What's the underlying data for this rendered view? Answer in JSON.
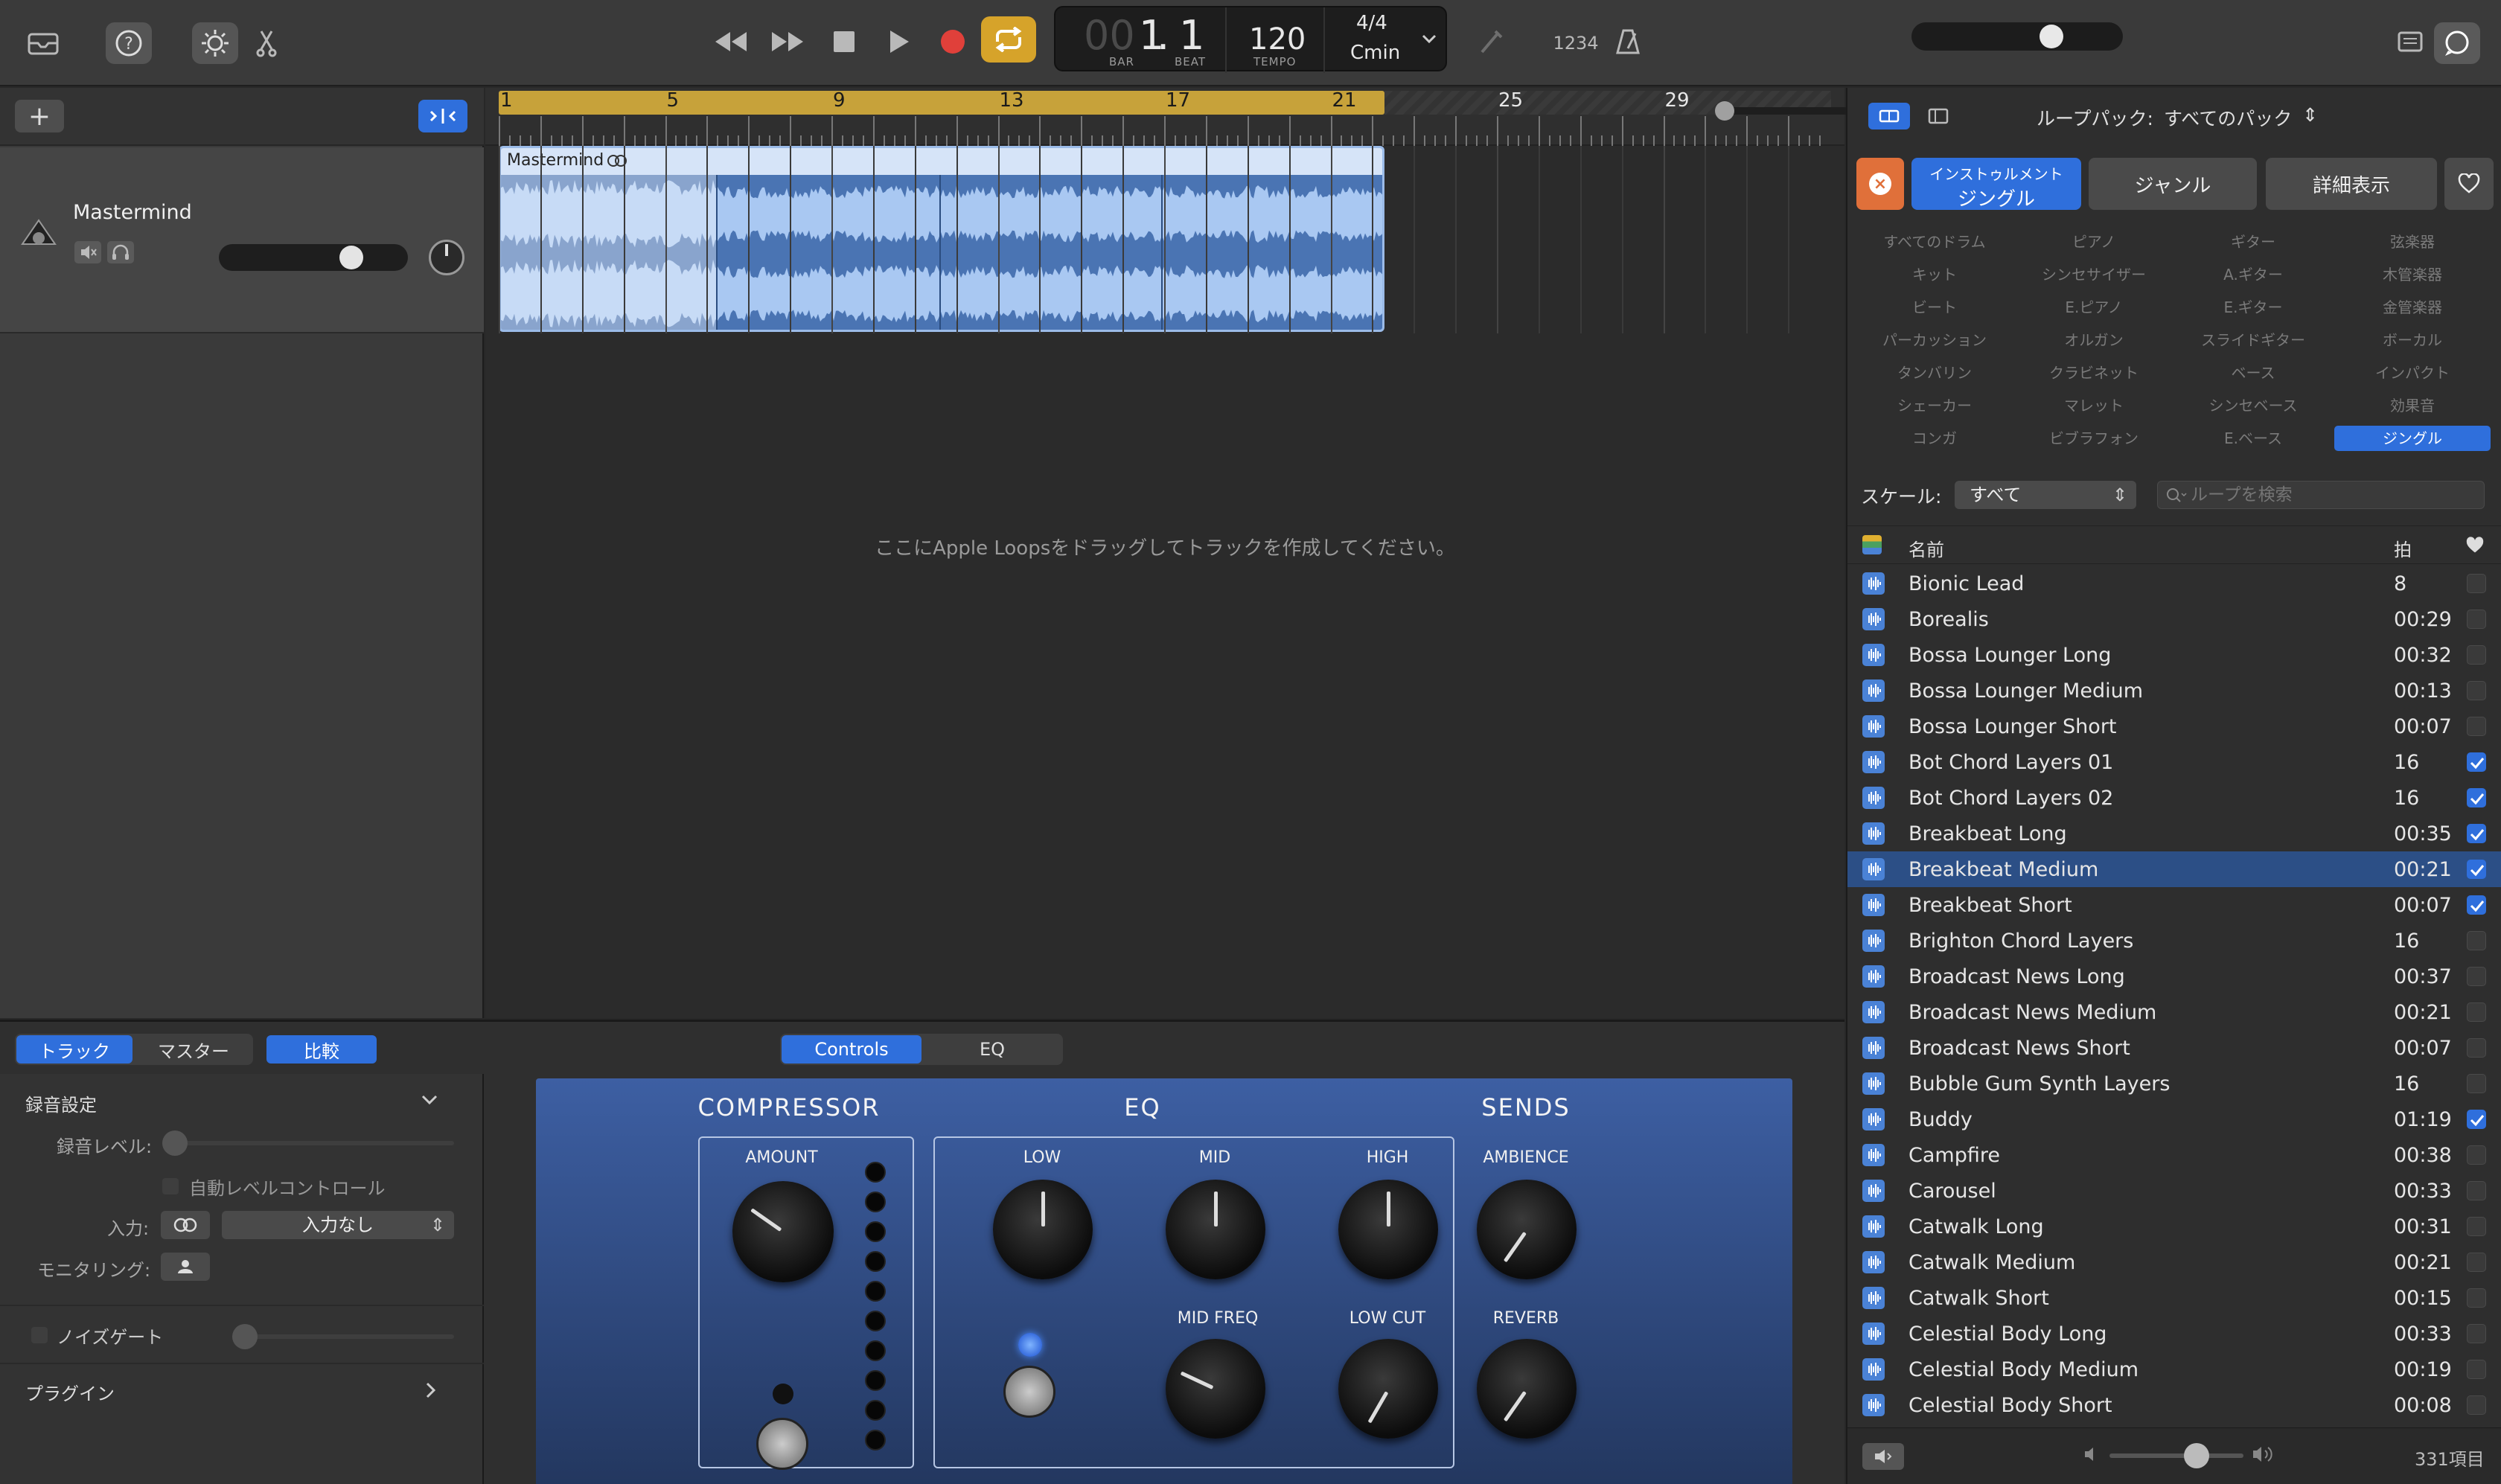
{
  "toolbar": {
    "lcd": {
      "bar_prefix": "00",
      "bar": "1",
      "beat": "1",
      "bar_label": "BAR",
      "beat_label": "BEAT",
      "tempo": "120",
      "tempo_label": "TEMPO",
      "signature": "4/4",
      "key": "Cmin"
    },
    "count_in": "1234",
    "accent_color": "#d6a32a"
  },
  "tracks": {
    "add_label": "+",
    "items": [
      {
        "name": "Mastermind"
      }
    ]
  },
  "arrangement": {
    "ruler_marks": [
      "1",
      "5",
      "9",
      "13",
      "17",
      "21",
      "25",
      "29"
    ],
    "region_name": "Mastermind",
    "empty_hint": "ここにApple Loopsをドラッグしてトラックを作成してください。"
  },
  "browser": {
    "loop_pack_label": "ループパック:",
    "loop_pack_value": "すべてのパック",
    "filter_tag_line1": "インストゥルメント",
    "filter_tag_line2": "ジングル",
    "genre_tab": "ジャンル",
    "details_tab": "詳細表示",
    "categories": [
      [
        "すべてのドラム",
        "ピアノ",
        "ギター",
        "弦楽器"
      ],
      [
        "キット",
        "シンセサイザー",
        "A.ギター",
        "木管楽器"
      ],
      [
        "ビート",
        "E.ピアノ",
        "E.ギター",
        "金管楽器"
      ],
      [
        "パーカッション",
        "オルガン",
        "スライドギター",
        "ボーカル"
      ],
      [
        "タンバリン",
        "クラビネット",
        "ベース",
        "インパクト"
      ],
      [
        "シェーカー",
        "マレット",
        "シンセベース",
        "効果音"
      ],
      [
        "コンガ",
        "ビブラフォン",
        "E.ベース",
        "ジングル"
      ]
    ],
    "selected_category": "ジングル",
    "scale_label": "スケール:",
    "scale_value": "すべて",
    "search_placeholder": "ループを検索",
    "col_name": "名前",
    "col_beats": "拍",
    "loops": [
      {
        "name": "Bionic Lead",
        "beats": "8",
        "fav": false
      },
      {
        "name": "Borealis",
        "beats": "00:29",
        "fav": false
      },
      {
        "name": "Bossa Lounger Long",
        "beats": "00:32",
        "fav": false
      },
      {
        "name": "Bossa Lounger Medium",
        "beats": "00:13",
        "fav": false
      },
      {
        "name": "Bossa Lounger Short",
        "beats": "00:07",
        "fav": false
      },
      {
        "name": "Bot Chord Layers 01",
        "beats": "16",
        "fav": true
      },
      {
        "name": "Bot Chord Layers 02",
        "beats": "16",
        "fav": true
      },
      {
        "name": "Breakbeat Long",
        "beats": "00:35",
        "fav": true
      },
      {
        "name": "Breakbeat Medium",
        "beats": "00:21",
        "fav": true,
        "selected": true
      },
      {
        "name": "Breakbeat Short",
        "beats": "00:07",
        "fav": true
      },
      {
        "name": "Brighton Chord Layers",
        "beats": "16",
        "fav": false
      },
      {
        "name": "Broadcast News Long",
        "beats": "00:37",
        "fav": false
      },
      {
        "name": "Broadcast News Medium",
        "beats": "00:21",
        "fav": false
      },
      {
        "name": "Broadcast News Short",
        "beats": "00:07",
        "fav": false
      },
      {
        "name": "Bubble Gum Synth Layers",
        "beats": "16",
        "fav": false
      },
      {
        "name": "Buddy",
        "beats": "01:19",
        "fav": true
      },
      {
        "name": "Campfire",
        "beats": "00:38",
        "fav": false
      },
      {
        "name": "Carousel",
        "beats": "00:33",
        "fav": false
      },
      {
        "name": "Catwalk Long",
        "beats": "00:31",
        "fav": false
      },
      {
        "name": "Catwalk Medium",
        "beats": "00:21",
        "fav": false
      },
      {
        "name": "Catwalk Short",
        "beats": "00:15",
        "fav": false
      },
      {
        "name": "Celestial Body Long",
        "beats": "00:33",
        "fav": false
      },
      {
        "name": "Celestial Body Medium",
        "beats": "00:19",
        "fav": false
      },
      {
        "name": "Celestial Body Short",
        "beats": "00:08",
        "fav": false
      }
    ],
    "item_count": "331項目"
  },
  "smart_controls": {
    "tabs": [
      "トラック",
      "マスター"
    ],
    "compare": "比較",
    "view_tabs": [
      "Controls",
      "EQ"
    ],
    "record_settings": "録音設定",
    "record_level": "録音レベル:",
    "auto_level": "自動レベルコントロール",
    "input_label": "入力:",
    "input_value": "入力なし",
    "monitoring_label": "モニタリング:",
    "noise_gate": "ノイズゲート",
    "plugins": "プラグイン",
    "plugin": {
      "compressor": "COMPRESSOR",
      "eq": "EQ",
      "sends": "SENDS",
      "amount": "AMOUNT",
      "low": "LOW",
      "mid": "MID",
      "high": "HIGH",
      "mid_freq": "MID FREQ",
      "low_cut": "LOW CUT",
      "ambience": "AMBIENCE",
      "reverb": "REVERB"
    }
  }
}
